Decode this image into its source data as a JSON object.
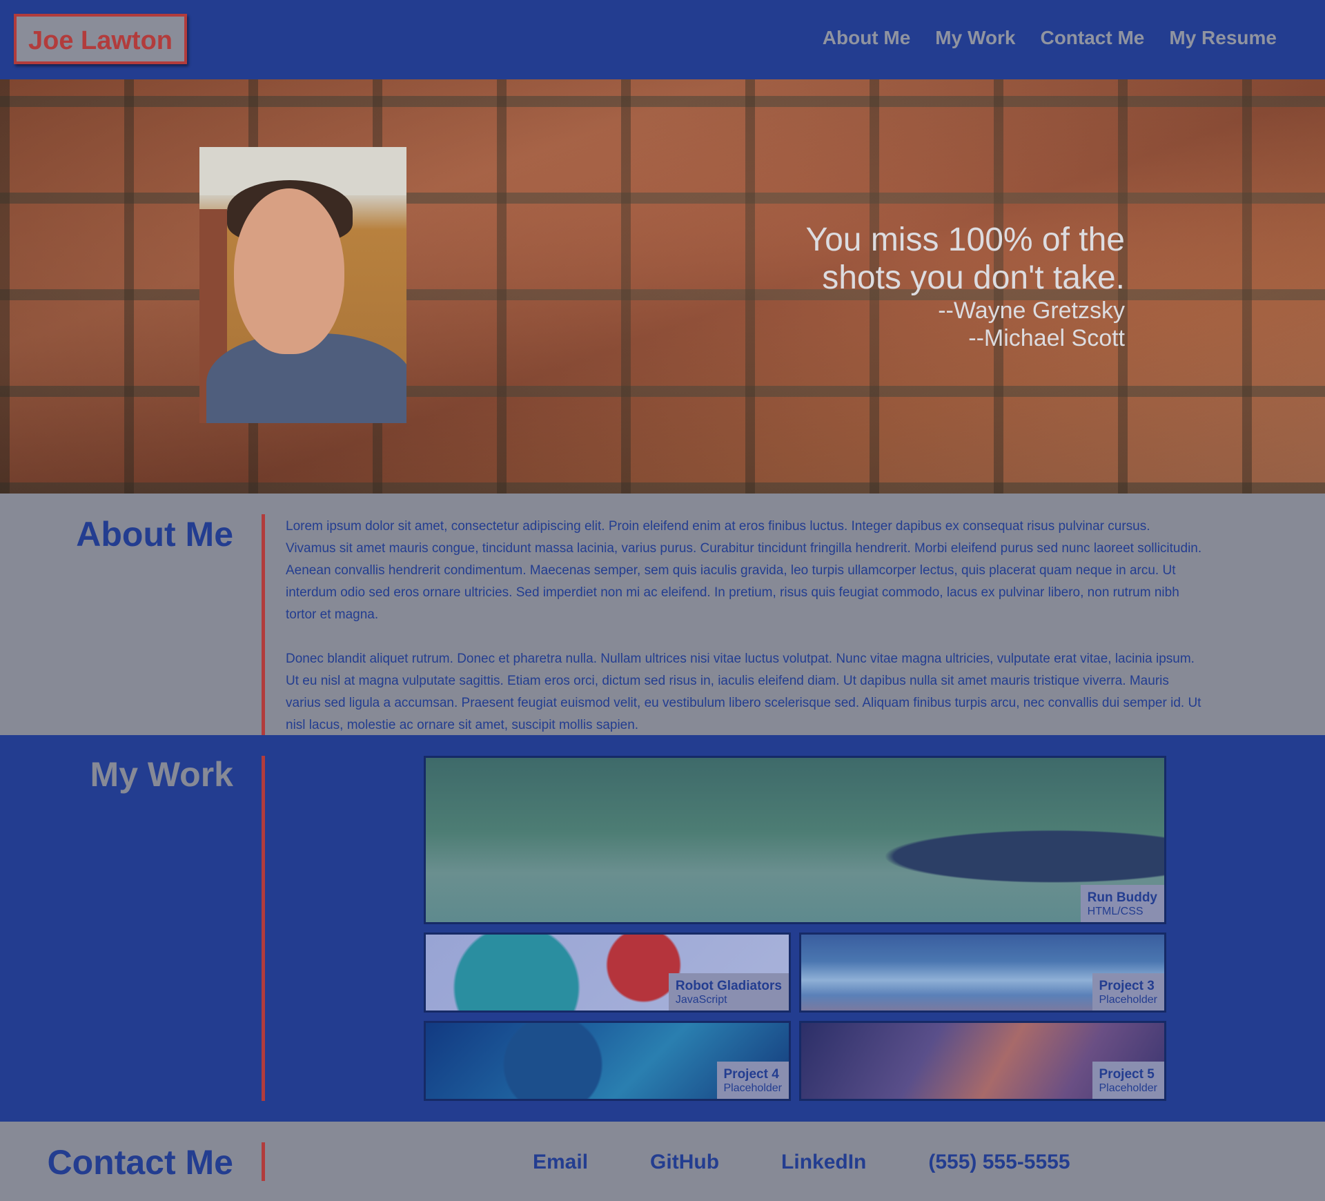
{
  "header": {
    "logo": "Joe Lawton",
    "nav": [
      "About Me",
      "My Work",
      "Contact Me",
      "My Resume"
    ]
  },
  "hero": {
    "quote_lines": [
      "You miss 100% of the",
      "shots you don't take."
    ],
    "attributions": [
      "--Wayne Gretzsky",
      "--Michael Scott"
    ]
  },
  "about": {
    "title": "About Me",
    "paragraphs": [
      "Lorem ipsum dolor sit amet, consectetur adipiscing elit. Proin eleifend enim at eros finibus luctus. Integer dapibus ex consequat risus pulvinar cursus. Vivamus sit amet mauris congue, tincidunt massa lacinia, varius purus. Curabitur tincidunt fringilla hendrerit. Morbi eleifend purus sed nunc laoreet sollicitudin. Aenean convallis hendrerit condimentum. Maecenas semper, sem quis iaculis gravida, leo turpis ullamcorper lectus, quis placerat quam neque in arcu. Ut interdum odio sed eros ornare ultricies. Sed imperdiet non mi ac eleifend. In pretium, risus quis feugiat commodo, lacus ex pulvinar libero, non rutrum nibh tortor et magna.",
      "Donec blandit aliquet rutrum. Donec et pharetra nulla. Nullam ultrices nisi vitae luctus volutpat. Nunc vitae magna ultricies, vulputate erat vitae, lacinia ipsum. Ut eu nisl at magna vulputate sagittis. Etiam eros orci, dictum sed risus in, iaculis eleifend diam. Ut dapibus nulla sit amet mauris tristique viverra. Mauris varius sed ligula a accumsan. Praesent feugiat euismod velit, eu vestibulum libero scelerisque sed. Aliquam finibus turpis arcu, nec convallis dui semper id. Ut nisl lacus, molestie ac ornare sit amet, suscipit mollis sapien."
    ]
  },
  "work": {
    "title": "My Work",
    "projects": [
      {
        "name": "Run Buddy",
        "lang": "HTML/CSS"
      },
      {
        "name": "Robot Gladiators",
        "lang": "JavaScript"
      },
      {
        "name": "Project 3",
        "lang": "Placeholder"
      },
      {
        "name": "Project 4",
        "lang": "Placeholder"
      },
      {
        "name": "Project 5",
        "lang": "Placeholder"
      }
    ]
  },
  "contact": {
    "title": "Contact Me",
    "links": [
      "Email",
      "GitHub",
      "LinkedIn",
      "(555) 555-5555"
    ]
  },
  "colors": {
    "primary_blue": "#233d90",
    "gray": "#878a96",
    "accent_red": "#b23c3c"
  }
}
